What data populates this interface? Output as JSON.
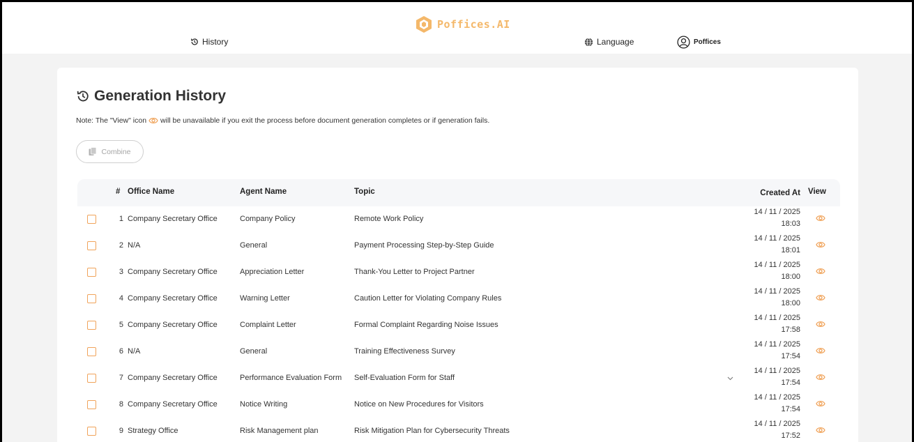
{
  "brand": {
    "name": "Poffices.AI",
    "color": "#f4b86a"
  },
  "nav": {
    "history": "History",
    "language": "Language",
    "account": "Poffices"
  },
  "page": {
    "title": "Generation History",
    "note_before": "Note: The \"View\" icon",
    "note_after": "will be unavailable if you exit the process before document generation completes or if generation fails.",
    "combine_label": "Combine"
  },
  "table": {
    "headers": {
      "num": "#",
      "office": "Office Name",
      "agent": "Agent Name",
      "topic": "Topic",
      "created": "Created At",
      "view": "View"
    },
    "rows": [
      {
        "num": "1",
        "office": "Company Secretary Office",
        "agent": "Company Policy",
        "topic": "Remote Work Policy",
        "date": "14 / 11 / 2025",
        "time": "18:03"
      },
      {
        "num": "2",
        "office": "N/A",
        "agent": "General",
        "topic": "Payment Processing Step-by-Step Guide",
        "date": "14 / 11 / 2025",
        "time": "18:01"
      },
      {
        "num": "3",
        "office": "Company Secretary Office",
        "agent": "Appreciation Letter",
        "topic": "Thank-You Letter to Project Partner",
        "date": "14 / 11 / 2025",
        "time": "18:00"
      },
      {
        "num": "4",
        "office": "Company Secretary Office",
        "agent": "Warning Letter",
        "topic": "Caution Letter for Violating Company Rules",
        "date": "14 / 11 / 2025",
        "time": "18:00"
      },
      {
        "num": "5",
        "office": "Company Secretary Office",
        "agent": "Complaint Letter",
        "topic": "Formal Complaint Regarding Noise Issues",
        "date": "14 / 11 / 2025",
        "time": "17:58"
      },
      {
        "num": "6",
        "office": "N/A",
        "agent": "General",
        "topic": "Training Effectiveness Survey",
        "date": "14 / 11 / 2025",
        "time": "17:54"
      },
      {
        "num": "7",
        "office": "Company Secretary Office",
        "agent": "Performance Evaluation Form",
        "topic": "Self-Evaluation Form for Staff",
        "date": "14 / 11 / 2025",
        "time": "17:54"
      },
      {
        "num": "8",
        "office": "Company Secretary Office",
        "agent": "Notice Writing",
        "topic": "Notice on New Procedures for Visitors",
        "date": "14 / 11 / 2025",
        "time": "17:54"
      },
      {
        "num": "9",
        "office": "Strategy Office",
        "agent": "Risk Management plan",
        "topic": "Risk Mitigation Plan for Cybersecurity Threats",
        "date": "14 / 11 / 2025",
        "time": "17:52"
      }
    ]
  },
  "icons": {
    "history": "history-icon",
    "language": "globe-icon",
    "account": "user-circle-icon",
    "view": "eye-icon",
    "combine": "copy-icon",
    "expand": "chevron-down-icon"
  },
  "colors": {
    "accent": "#f0a35a"
  }
}
